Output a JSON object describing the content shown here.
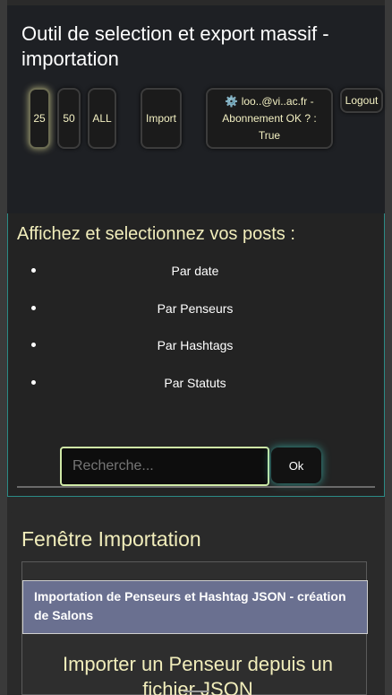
{
  "header": {
    "title": "Outil de selection et export massif - importation",
    "buttons": {
      "b25": "25",
      "b50": "50",
      "ball": "ALL",
      "import": "Import",
      "account": "⚙️ loo..@vi..ac.fr - Abonnement OK ? : True",
      "logout": "Logout"
    }
  },
  "posts": {
    "title": "Affichez et selectionnez vos posts :",
    "items": [
      "Par date",
      "Par Penseurs",
      "Par Hashtags",
      "Par Statuts"
    ],
    "search_placeholder": "Recherche...",
    "ok_label": "Ok"
  },
  "import": {
    "title": "Fenêtre Importation",
    "banner": "Importation de Penseurs et Hashtag JSON - création de Salons",
    "subtitle": "Importer un Penseur depuis un fichier JSON"
  },
  "colors": {
    "accent": "#f1edbb",
    "teal_glow": "#3cc8be",
    "banner_bg": "#6a7090"
  }
}
